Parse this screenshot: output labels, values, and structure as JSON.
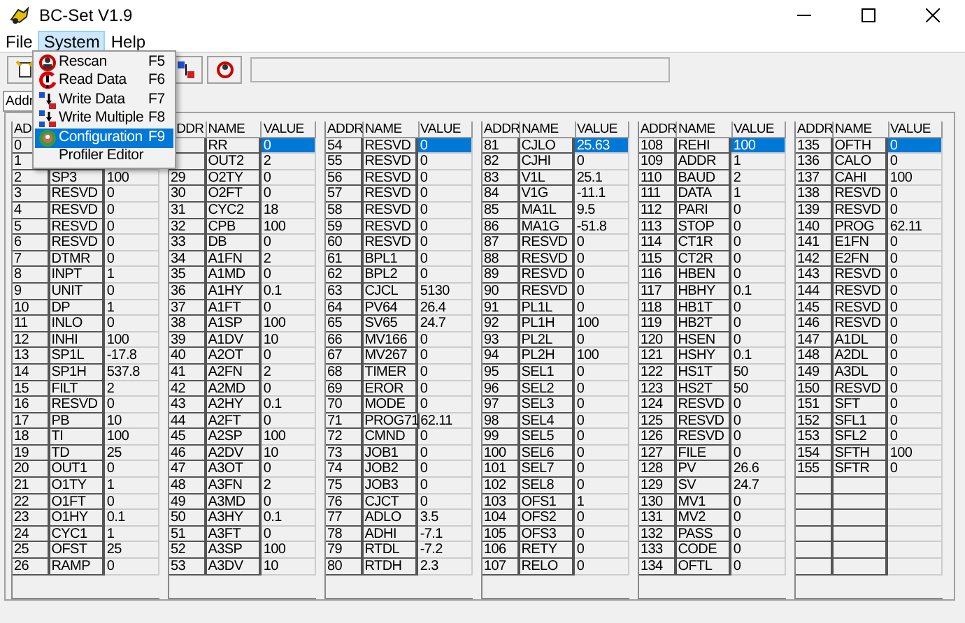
{
  "window": {
    "title": "BC-Set V1.9"
  },
  "menu_bar": [
    {
      "label": "File",
      "selected": false
    },
    {
      "label": "System",
      "selected": true
    },
    {
      "label": "Help",
      "selected": false
    }
  ],
  "system_menu": [
    {
      "kind": "rescan",
      "label": "Rescan",
      "shortcut": "F5",
      "selected": false
    },
    {
      "kind": "read",
      "label": "Read Data",
      "shortcut": "F6",
      "selected": false
    },
    {
      "kind": "write",
      "label": "Write Data",
      "shortcut": "F7",
      "selected": false
    },
    {
      "kind": "write_multiple",
      "label": "Write Multiple",
      "shortcut": "F8",
      "selected": false
    },
    {
      "kind": "config",
      "label": "Configuration",
      "shortcut": "F9",
      "selected": true
    },
    {
      "kind": "none",
      "label": "Profiler Editor",
      "selected": false
    }
  ],
  "address_tab": {
    "label": "Addr"
  },
  "tables": [
    {
      "columns": [
        "AD"
      ],
      "rows": [
        {
          "addr": "0"
        },
        {
          "addr": "1"
        },
        {
          "addr": "2",
          "name": "SP3",
          "value": "100",
          "selected": false
        },
        {
          "addr": "3",
          "name": "RESVD",
          "value": "0",
          "selected": false
        },
        {
          "addr": "4",
          "name": "RESVD",
          "value": "0",
          "selected": false
        },
        {
          "addr": "5",
          "name": "RESVD",
          "value": "0",
          "selected": false
        },
        {
          "addr": "6",
          "name": "RESVD",
          "value": "0",
          "selected": false
        },
        {
          "addr": "7",
          "name": "DTMR",
          "value": "0",
          "selected": false
        },
        {
          "addr": "8",
          "name": "INPT",
          "value": "1",
          "selected": false
        },
        {
          "addr": "9",
          "name": "UNIT",
          "value": "0",
          "selected": false
        },
        {
          "addr": "10",
          "name": "DP",
          "value": "1",
          "selected": false
        },
        {
          "addr": "11",
          "name": "INLO",
          "value": "0",
          "selected": false
        },
        {
          "addr": "12",
          "name": "INHI",
          "value": "100",
          "selected": false
        },
        {
          "addr": "13",
          "name": "SP1L",
          "value": "-17.8",
          "selected": false
        },
        {
          "addr": "14",
          "name": "SP1H",
          "value": "537.8",
          "selected": false
        },
        {
          "addr": "15",
          "name": "FILT",
          "value": "2",
          "selected": false
        },
        {
          "addr": "16",
          "name": "RESVD",
          "value": "0",
          "selected": false
        },
        {
          "addr": "17",
          "name": "PB",
          "value": "10",
          "selected": false
        },
        {
          "addr": "18",
          "name": "TI",
          "value": "100",
          "selected": false
        },
        {
          "addr": "19",
          "name": "TD",
          "value": "25",
          "selected": false
        },
        {
          "addr": "20",
          "name": "OUT1",
          "value": "0",
          "selected": false
        },
        {
          "addr": "21",
          "name": "O1TY",
          "value": "1",
          "selected": false
        },
        {
          "addr": "22",
          "name": "O1FT",
          "value": "0",
          "selected": false
        },
        {
          "addr": "23",
          "name": "O1HY",
          "value": "0.1",
          "selected": false
        },
        {
          "addr": "24",
          "name": "CYC1",
          "value": "1",
          "selected": false
        },
        {
          "addr": "25",
          "name": "OFST",
          "value": "25",
          "selected": false
        },
        {
          "addr": "26",
          "name": "RAMP",
          "value": "0",
          "selected": false
        }
      ]
    },
    {
      "columns": [
        "DDR",
        "NAME",
        "VALUE"
      ],
      "rows": [
        {
          "name": "RR",
          "value": "0",
          "selected": true
        },
        {
          "name": "OUT2",
          "value": "2",
          "selected": false
        },
        {
          "addr": "29",
          "name": "O2TY",
          "value": "0",
          "selected": false
        },
        {
          "addr": "30",
          "name": "O2FT",
          "value": "0",
          "selected": false
        },
        {
          "addr": "31",
          "name": "CYC2",
          "value": "18",
          "selected": false
        },
        {
          "addr": "32",
          "name": "CPB",
          "value": "100",
          "selected": false
        },
        {
          "addr": "33",
          "name": "DB",
          "value": "0",
          "selected": false
        },
        {
          "addr": "34",
          "name": "A1FN",
          "value": "2",
          "selected": false
        },
        {
          "addr": "35",
          "name": "A1MD",
          "value": "0",
          "selected": false
        },
        {
          "addr": "36",
          "name": "A1HY",
          "value": "0.1",
          "selected": false
        },
        {
          "addr": "37",
          "name": "A1FT",
          "value": "0",
          "selected": false
        },
        {
          "addr": "38",
          "name": "A1SP",
          "value": "100",
          "selected": false
        },
        {
          "addr": "39",
          "name": "A1DV",
          "value": "10",
          "selected": false
        },
        {
          "addr": "40",
          "name": "A2OT",
          "value": "0",
          "selected": false
        },
        {
          "addr": "41",
          "name": "A2FN",
          "value": "2",
          "selected": false
        },
        {
          "addr": "42",
          "name": "A2MD",
          "value": "0",
          "selected": false
        },
        {
          "addr": "43",
          "name": "A2HY",
          "value": "0.1",
          "selected": false
        },
        {
          "addr": "44",
          "name": "A2FT",
          "value": "0",
          "selected": false
        },
        {
          "addr": "45",
          "name": "A2SP",
          "value": "100",
          "selected": false
        },
        {
          "addr": "46",
          "name": "A2DV",
          "value": "10",
          "selected": false
        },
        {
          "addr": "47",
          "name": "A3OT",
          "value": "0",
          "selected": false
        },
        {
          "addr": "48",
          "name": "A3FN",
          "value": "2",
          "selected": false
        },
        {
          "addr": "49",
          "name": "A3MD",
          "value": "0",
          "selected": false
        },
        {
          "addr": "50",
          "name": "A3HY",
          "value": "0.1",
          "selected": false
        },
        {
          "addr": "51",
          "name": "A3FT",
          "value": "0",
          "selected": false
        },
        {
          "addr": "52",
          "name": "A3SP",
          "value": "100",
          "selected": false
        },
        {
          "addr": "53",
          "name": "A3DV",
          "value": "10",
          "selected": false
        }
      ]
    },
    {
      "columns": [
        "ADDR",
        "NAME",
        "VALUE"
      ],
      "rows": [
        {
          "addr": "54",
          "name": "RESVD",
          "value": "0",
          "selected": true
        },
        {
          "addr": "55",
          "name": "RESVD",
          "value": "0",
          "selected": false
        },
        {
          "addr": "56",
          "name": "RESVD",
          "value": "0",
          "selected": false
        },
        {
          "addr": "57",
          "name": "RESVD",
          "value": "0",
          "selected": false
        },
        {
          "addr": "58",
          "name": "RESVD",
          "value": "0",
          "selected": false
        },
        {
          "addr": "59",
          "name": "RESVD",
          "value": "0",
          "selected": false
        },
        {
          "addr": "60",
          "name": "RESVD",
          "value": "0",
          "selected": false
        },
        {
          "addr": "61",
          "name": "BPL1",
          "value": "0",
          "selected": false
        },
        {
          "addr": "62",
          "name": "BPL2",
          "value": "0",
          "selected": false
        },
        {
          "addr": "63",
          "name": "CJCL",
          "value": "5130",
          "selected": false
        },
        {
          "addr": "64",
          "name": "PV64",
          "value": "26.4",
          "selected": false
        },
        {
          "addr": "65",
          "name": "SV65",
          "value": "24.7",
          "selected": false
        },
        {
          "addr": "66",
          "name": "MV166",
          "value": "0",
          "selected": false
        },
        {
          "addr": "67",
          "name": "MV267",
          "value": "0",
          "selected": false
        },
        {
          "addr": "68",
          "name": "TIMER",
          "value": "0",
          "selected": false
        },
        {
          "addr": "69",
          "name": "EROR",
          "value": "0",
          "selected": false
        },
        {
          "addr": "70",
          "name": "MODE",
          "value": "0",
          "selected": false
        },
        {
          "addr": "71",
          "name": "PROG71",
          "value": "62.11",
          "selected": false
        },
        {
          "addr": "72",
          "name": "CMND",
          "value": "0",
          "selected": false
        },
        {
          "addr": "73",
          "name": "JOB1",
          "value": "0",
          "selected": false
        },
        {
          "addr": "74",
          "name": "JOB2",
          "value": "0",
          "selected": false
        },
        {
          "addr": "75",
          "name": "JOB3",
          "value": "0",
          "selected": false
        },
        {
          "addr": "76",
          "name": "CJCT",
          "value": "0",
          "selected": false
        },
        {
          "addr": "77",
          "name": "ADLO",
          "value": "3.5",
          "selected": false
        },
        {
          "addr": "78",
          "name": "ADHI",
          "value": "-7.1",
          "selected": false
        },
        {
          "addr": "79",
          "name": "RTDL",
          "value": "-7.2",
          "selected": false
        },
        {
          "addr": "80",
          "name": "RTDH",
          "value": "2.3",
          "selected": false
        }
      ]
    },
    {
      "columns": [
        "ADDR",
        "NAME",
        "VALUE"
      ],
      "rows": [
        {
          "addr": "81",
          "name": "CJLO",
          "value": "25.63",
          "selected": true
        },
        {
          "addr": "82",
          "name": "CJHI",
          "value": "0",
          "selected": false
        },
        {
          "addr": "83",
          "name": "V1L",
          "value": "25.1",
          "selected": false
        },
        {
          "addr": "84",
          "name": "V1G",
          "value": "-11.1",
          "selected": false
        },
        {
          "addr": "85",
          "name": "MA1L",
          "value": "9.5",
          "selected": false
        },
        {
          "addr": "86",
          "name": "MA1G",
          "value": "-51.8",
          "selected": false
        },
        {
          "addr": "87",
          "name": "RESVD",
          "value": "0",
          "selected": false
        },
        {
          "addr": "88",
          "name": "RESVD",
          "value": "0",
          "selected": false
        },
        {
          "addr": "89",
          "name": "RESVD",
          "value": "0",
          "selected": false
        },
        {
          "addr": "90",
          "name": "RESVD",
          "value": "0",
          "selected": false
        },
        {
          "addr": "91",
          "name": "PL1L",
          "value": "0",
          "selected": false
        },
        {
          "addr": "92",
          "name": "PL1H",
          "value": "100",
          "selected": false
        },
        {
          "addr": "93",
          "name": "PL2L",
          "value": "0",
          "selected": false
        },
        {
          "addr": "94",
          "name": "PL2H",
          "value": "100",
          "selected": false
        },
        {
          "addr": "95",
          "name": "SEL1",
          "value": "0",
          "selected": false
        },
        {
          "addr": "96",
          "name": "SEL2",
          "value": "0",
          "selected": false
        },
        {
          "addr": "97",
          "name": "SEL3",
          "value": "0",
          "selected": false
        },
        {
          "addr": "98",
          "name": "SEL4",
          "value": "0",
          "selected": false
        },
        {
          "addr": "99",
          "name": "SEL5",
          "value": "0",
          "selected": false
        },
        {
          "addr": "100",
          "name": "SEL6",
          "value": "0",
          "selected": false
        },
        {
          "addr": "101",
          "name": "SEL7",
          "value": "0",
          "selected": false
        },
        {
          "addr": "102",
          "name": "SEL8",
          "value": "0",
          "selected": false
        },
        {
          "addr": "103",
          "name": "OFS1",
          "value": "1",
          "selected": false
        },
        {
          "addr": "104",
          "name": "OFS2",
          "value": "0",
          "selected": false
        },
        {
          "addr": "105",
          "name": "OFS3",
          "value": "0",
          "selected": false
        },
        {
          "addr": "106",
          "name": "RETY",
          "value": "0",
          "selected": false
        },
        {
          "addr": "107",
          "name": "RELO",
          "value": "0",
          "selected": false
        }
      ]
    },
    {
      "columns": [
        "ADDR",
        "NAME",
        "VALUE"
      ],
      "rows": [
        {
          "addr": "108",
          "name": "REHI",
          "value": "100",
          "selected": true
        },
        {
          "addr": "109",
          "name": "ADDR",
          "value": "1",
          "selected": false
        },
        {
          "addr": "110",
          "name": "BAUD",
          "value": "2",
          "selected": false
        },
        {
          "addr": "111",
          "name": "DATA",
          "value": "1",
          "selected": false
        },
        {
          "addr": "112",
          "name": "PARI",
          "value": "0",
          "selected": false
        },
        {
          "addr": "113",
          "name": "STOP",
          "value": "0",
          "selected": false
        },
        {
          "addr": "114",
          "name": "CT1R",
          "value": "0",
          "selected": false
        },
        {
          "addr": "115",
          "name": "CT2R",
          "value": "0",
          "selected": false
        },
        {
          "addr": "116",
          "name": "HBEN",
          "value": "0",
          "selected": false
        },
        {
          "addr": "117",
          "name": "HBHY",
          "value": "0.1",
          "selected": false
        },
        {
          "addr": "118",
          "name": "HB1T",
          "value": "0",
          "selected": false
        },
        {
          "addr": "119",
          "name": "HB2T",
          "value": "0",
          "selected": false
        },
        {
          "addr": "120",
          "name": "HSEN",
          "value": "0",
          "selected": false
        },
        {
          "addr": "121",
          "name": "HSHY",
          "value": "0.1",
          "selected": false
        },
        {
          "addr": "122",
          "name": "HS1T",
          "value": "50",
          "selected": false
        },
        {
          "addr": "123",
          "name": "HS2T",
          "value": "50",
          "selected": false
        },
        {
          "addr": "124",
          "name": "RESVD",
          "value": "0",
          "selected": false
        },
        {
          "addr": "125",
          "name": "RESVD",
          "value": "0",
          "selected": false
        },
        {
          "addr": "126",
          "name": "RESVD",
          "value": "0",
          "selected": false
        },
        {
          "addr": "127",
          "name": "FILE",
          "value": "0",
          "selected": false
        },
        {
          "addr": "128",
          "name": "PV",
          "value": "26.6",
          "selected": false
        },
        {
          "addr": "129",
          "name": "SV",
          "value": "24.7",
          "selected": false
        },
        {
          "addr": "130",
          "name": "MV1",
          "value": "0",
          "selected": false
        },
        {
          "addr": "131",
          "name": "MV2",
          "value": "0",
          "selected": false
        },
        {
          "addr": "132",
          "name": "PASS",
          "value": "0",
          "selected": false
        },
        {
          "addr": "133",
          "name": "CODE",
          "value": "0",
          "selected": false
        },
        {
          "addr": "134",
          "name": "OFTL",
          "value": "0",
          "selected": false
        }
      ]
    },
    {
      "columns": [
        "ADDR",
        "NAME",
        "VALUE"
      ],
      "rows": [
        {
          "addr": "135",
          "name": "OFTH",
          "value": "0",
          "selected": true
        },
        {
          "addr": "136",
          "name": "CALO",
          "value": "0",
          "selected": false
        },
        {
          "addr": "137",
          "name": "CAHI",
          "value": "100",
          "selected": false
        },
        {
          "addr": "138",
          "name": "RESVD",
          "value": "0",
          "selected": false
        },
        {
          "addr": "139",
          "name": "RESVD",
          "value": "0",
          "selected": false
        },
        {
          "addr": "140",
          "name": "PROG",
          "value": "62.11",
          "selected": false
        },
        {
          "addr": "141",
          "name": "E1FN",
          "value": "0",
          "selected": false
        },
        {
          "addr": "142",
          "name": "E2FN",
          "value": "0",
          "selected": false
        },
        {
          "addr": "143",
          "name": "RESVD",
          "value": "0",
          "selected": false
        },
        {
          "addr": "144",
          "name": "RESVD",
          "value": "0",
          "selected": false
        },
        {
          "addr": "145",
          "name": "RESVD",
          "value": "0",
          "selected": false
        },
        {
          "addr": "146",
          "name": "RESVD",
          "value": "0",
          "selected": false
        },
        {
          "addr": "147",
          "name": "A1DL",
          "value": "0",
          "selected": false
        },
        {
          "addr": "148",
          "name": "A2DL",
          "value": "0",
          "selected": false
        },
        {
          "addr": "149",
          "name": "A3DL",
          "value": "0",
          "selected": false
        },
        {
          "addr": "150",
          "name": "RESVD",
          "value": "0",
          "selected": false
        },
        {
          "addr": "151",
          "name": "SFT",
          "value": "0",
          "selected": false
        },
        {
          "addr": "152",
          "name": "SFL1",
          "value": "0",
          "selected": false
        },
        {
          "addr": "153",
          "name": "SFL2",
          "value": "0",
          "selected": false
        },
        {
          "addr": "154",
          "name": "SFTH",
          "value": "100",
          "selected": false
        },
        {
          "addr": "155",
          "name": "SFTR",
          "value": "0",
          "selected": false
        }
      ]
    }
  ]
}
